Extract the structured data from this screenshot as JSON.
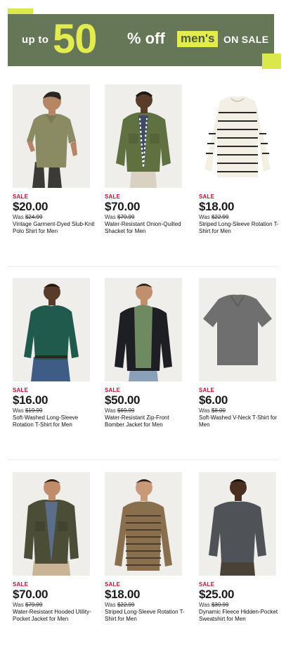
{
  "banner": {
    "up_to": "up to",
    "percent": "50",
    "percent_sign": "% off",
    "mens": "men's",
    "on_sale": "ON SALE"
  },
  "colors": {
    "banner_bg": "#667757",
    "accent": "#e2ec4f",
    "sale_red": "#c8102e"
  },
  "products": [
    {
      "sale": "SALE",
      "price": "$20.00",
      "was_label": "Was",
      "was_price": "$24.99",
      "name": "Vintage Garment-Dyed Slub-Knit Polo Shirt for Men",
      "icon": "olive-polo-shirt"
    },
    {
      "sale": "SALE",
      "price": "$70.00",
      "was_label": "Was",
      "was_price": "$79.99",
      "name": "Water-Resistant Onion-Quilted Shacket for Men",
      "icon": "green-quilted-shacket"
    },
    {
      "sale": "SALE",
      "price": "$18.00",
      "was_label": "Was",
      "was_price": "$22.99",
      "name": "Striped Long-Sleeve Rotation T-Shirt for Men",
      "icon": "striped-long-sleeve-tee"
    },
    {
      "sale": "SALE",
      "price": "$16.00",
      "was_label": "Was",
      "was_price": "$19.99",
      "name": "Soft-Washed Long-Sleeve Rotation T-Shirt for Men",
      "icon": "green-long-sleeve-tee"
    },
    {
      "sale": "SALE",
      "price": "$50.00",
      "was_label": "Was",
      "was_price": "$69.99",
      "name": "Water-Resistant Zip-Front Bomber Jacket for Men",
      "icon": "black-bomber-jacket"
    },
    {
      "sale": "SALE",
      "price": "$6.00",
      "was_label": "Was",
      "was_price": "$8.00",
      "name": "Soft-Washed V-Neck T-Shirt for Men",
      "icon": "gray-vneck-tee"
    },
    {
      "sale": "SALE",
      "price": "$70.00",
      "was_label": "Was",
      "was_price": "$79.99",
      "name": "Water-Resistant Hooded Utility-Pocket Jacket for Men",
      "icon": "olive-hooded-jacket"
    },
    {
      "sale": "SALE",
      "price": "$18.00",
      "was_label": "Was",
      "was_price": "$22.99",
      "name": "Striped Long-Sleeve Rotation T-Shirt for Men",
      "icon": "brown-striped-tee"
    },
    {
      "sale": "SALE",
      "price": "$25.00",
      "was_label": "Was",
      "was_price": "$39.99",
      "name": "Dynamic Fleece Hidden-Pocket Sweatshirt for Men",
      "icon": "charcoal-sweatshirt"
    }
  ]
}
